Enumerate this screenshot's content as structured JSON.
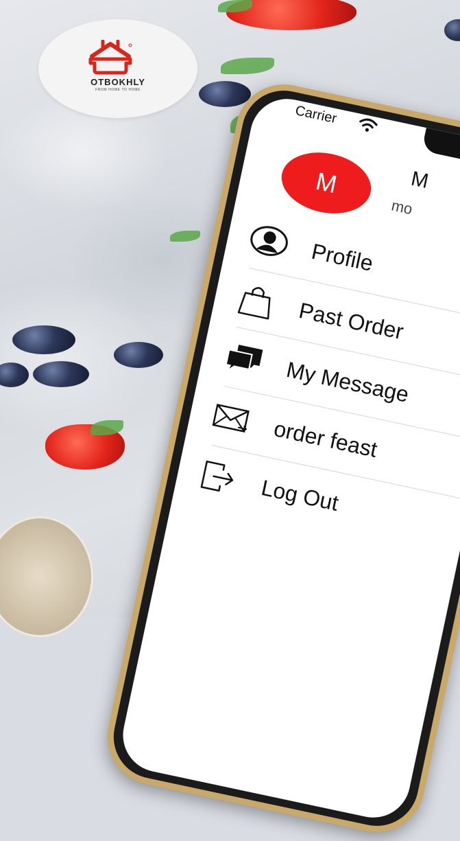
{
  "brand": {
    "name": "OTBOKHLY",
    "tagline": "FROM HOME TO HOME",
    "color": "#d7261e"
  },
  "status_bar": {
    "carrier": "Carrier",
    "wifi_icon": "wifi-icon"
  },
  "user": {
    "initial": "M",
    "name": "M",
    "email": "mo",
    "avatar_color": "#ee1c1c"
  },
  "menu": {
    "items": [
      {
        "label": "Profile",
        "icon": "person-icon"
      },
      {
        "label": "Past Order",
        "icon": "shopping-bag-icon"
      },
      {
        "label": "My Message",
        "icon": "chat-bubbles-icon"
      },
      {
        "label": "order feast",
        "icon": "envelope-icon"
      },
      {
        "label": "Log Out",
        "icon": "logout-icon"
      }
    ]
  }
}
